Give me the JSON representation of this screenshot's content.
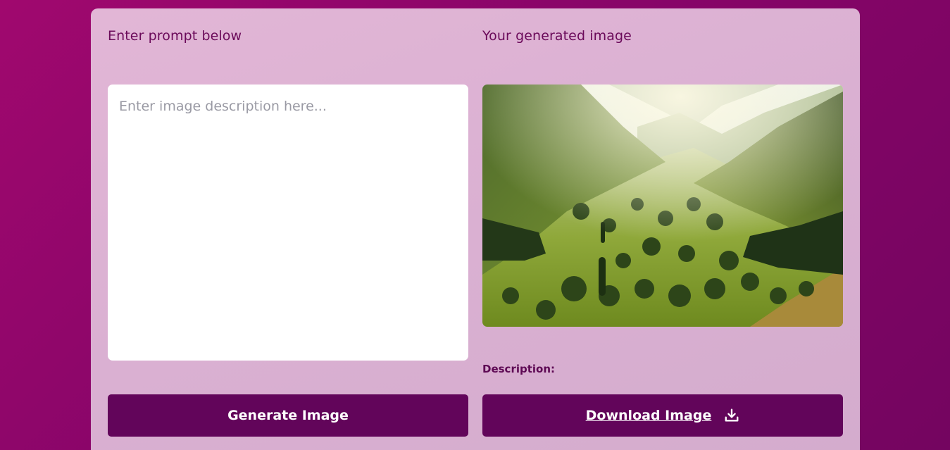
{
  "prompt_panel": {
    "heading": "Enter prompt below",
    "placeholder": "Enter image description here...",
    "value": "",
    "generate_label": "Generate Image"
  },
  "result_panel": {
    "heading": "Your generated image",
    "image_alt": "",
    "description_label": "Description:",
    "download_label": "Download Image",
    "download_icon": "download-icon"
  },
  "colors": {
    "background": "#8a0569",
    "card": "#dab0d2",
    "button": "#62055a",
    "heading_text": "#6b0a5a"
  }
}
